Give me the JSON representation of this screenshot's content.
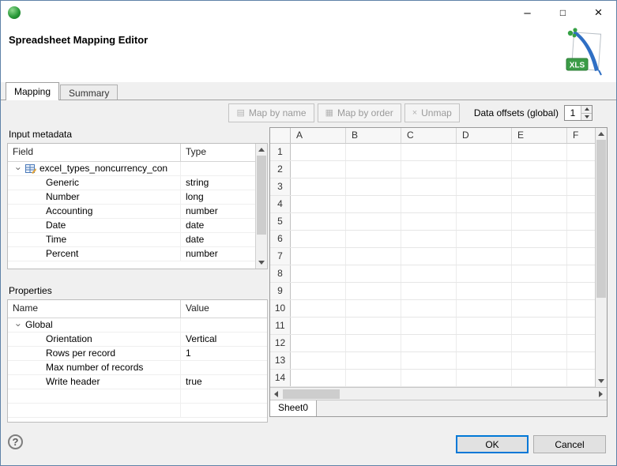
{
  "window": {
    "minimize_glyph": "–",
    "maximize_glyph": "□",
    "close_glyph": "×"
  },
  "header": {
    "title": "Spreadsheet Mapping Editor",
    "logo_label": "XLS"
  },
  "tabs": [
    {
      "label": "Mapping"
    },
    {
      "label": "Summary"
    }
  ],
  "icons": {
    "expanded": "›"
  },
  "toolbar": {
    "map_by_name": "Map by name",
    "map_by_name_icon": "▤",
    "map_by_order": "Map by order",
    "map_by_order_icon": "▦",
    "unmap": "Unmap",
    "unmap_icon": "×",
    "data_offsets_label": "Data offsets (global)",
    "data_offsets_value": "1"
  },
  "input_metadata": {
    "section_label": "Input metadata",
    "columns": {
      "field": "Field",
      "type": "Type"
    },
    "root_label": "excel_types_noncurrency_con",
    "rows": [
      {
        "field": "Generic",
        "type": "string"
      },
      {
        "field": "Number",
        "type": "long"
      },
      {
        "field": "Accounting",
        "type": "number"
      },
      {
        "field": "Date",
        "type": "date"
      },
      {
        "field": "Time",
        "type": "date"
      },
      {
        "field": "Percent",
        "type": "number"
      }
    ]
  },
  "properties": {
    "section_label": "Properties",
    "columns": {
      "name": "Name",
      "value": "Value"
    },
    "root_label": "Global",
    "rows": [
      {
        "name": "Orientation",
        "value": "Vertical"
      },
      {
        "name": "Rows per record",
        "value": "1"
      },
      {
        "name": "Max number of records",
        "value": ""
      },
      {
        "name": "Write header",
        "value": "true"
      }
    ]
  },
  "spreadsheet": {
    "column_headers": [
      "A",
      "B",
      "C",
      "D",
      "E",
      "F"
    ],
    "row_headers": [
      "1",
      "2",
      "3",
      "4",
      "5",
      "6",
      "7",
      "8",
      "9",
      "10",
      "11",
      "12",
      "13",
      "14"
    ],
    "sheet_tab": "Sheet0"
  },
  "footer": {
    "help_glyph": "?",
    "ok_label": "OK",
    "cancel_label": "Cancel"
  }
}
